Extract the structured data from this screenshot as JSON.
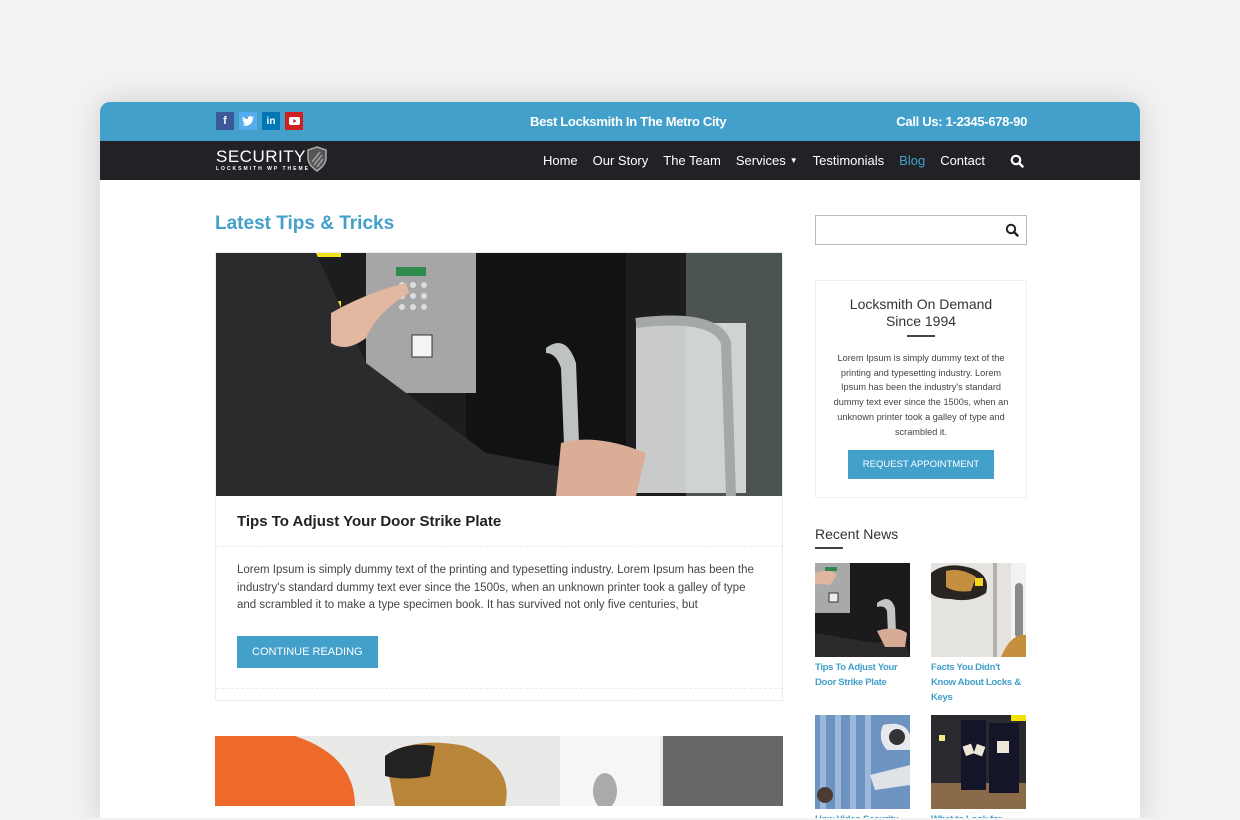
{
  "topbar": {
    "social": [
      {
        "icon": "facebook-icon",
        "glyph": "f"
      },
      {
        "icon": "twitter-icon",
        "glyph": "t"
      },
      {
        "icon": "linkedin-icon",
        "glyph": "in"
      },
      {
        "icon": "youtube-icon",
        "glyph": "▶"
      }
    ],
    "tagline": "Best Locksmith In The Metro City",
    "phone": "Call Us: 1-2345-678-90"
  },
  "logo": {
    "title": "SECURITY",
    "subtitle": "LOCKSMITH WP THEME"
  },
  "nav": {
    "items": [
      "Home",
      "Our Story",
      "The Team",
      "Services",
      "Testimonials",
      "Blog",
      "Contact"
    ],
    "active": "Blog"
  },
  "main": {
    "section_title": "Latest Tips & Tricks",
    "post": {
      "title": "Tips To Adjust Your Door Strike Plate",
      "excerpt": "Lorem Ipsum is simply dummy text of the printing and typesetting industry. Lorem Ipsum has been the industry's standard dummy text ever since the 1500s, when an unknown printer took a galley of type and scrambled it to make a type specimen book. It has survived not only five centuries, but",
      "button": "Continue Reading"
    }
  },
  "sidebar": {
    "search_placeholder": "",
    "widget": {
      "title_line1": "Locksmith On Demand",
      "title_line2": "Since 1994",
      "text": "Lorem Ipsum is simply dummy text of the printing and typesetting industry. Lorem Ipsum has been the industry's standard dummy text ever since the 1500s, when an unknown printer took a galley of type and scrambled it.",
      "button": "Request Appointment"
    },
    "recent_title": "Recent News",
    "recent": [
      {
        "caption": "Tips To Adjust Your Door Strike Plate"
      },
      {
        "caption": "Facts You Didn't Know About Locks & Keys"
      },
      {
        "caption": "How Video Security..."
      },
      {
        "caption": "What to Look for..."
      }
    ]
  },
  "colors": {
    "accent": "#42a0cb",
    "nav_bg": "#222226"
  }
}
